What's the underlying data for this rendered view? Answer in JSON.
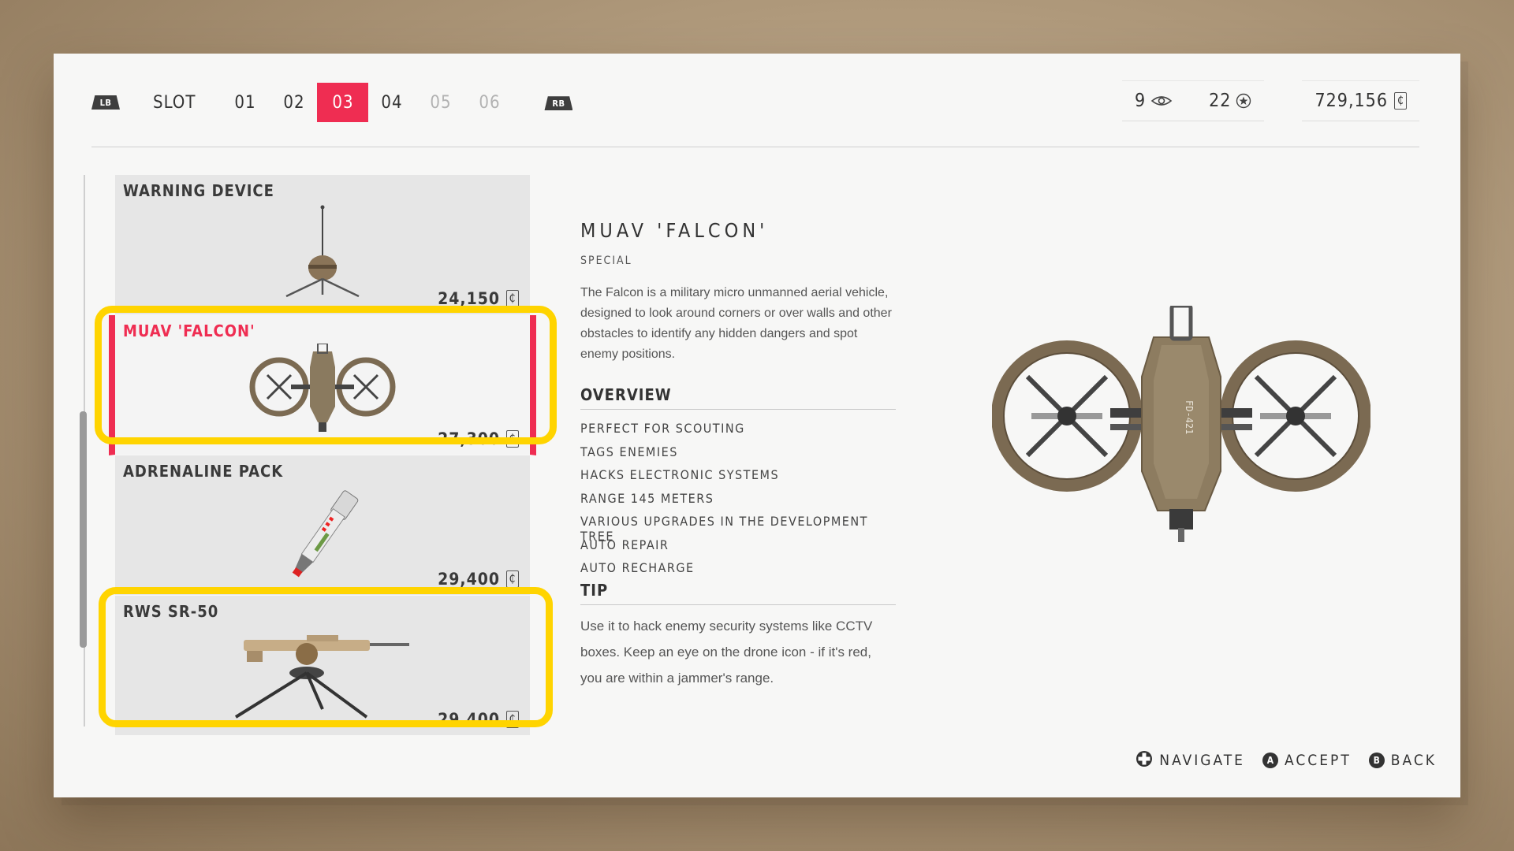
{
  "slot_bar": {
    "left_bumper": "LB",
    "label": "SLOT",
    "slots": [
      {
        "label": "01",
        "state": "normal"
      },
      {
        "label": "02",
        "state": "normal"
      },
      {
        "label": "03",
        "state": "active"
      },
      {
        "label": "04",
        "state": "normal"
      },
      {
        "label": "05",
        "state": "locked"
      },
      {
        "label": "06",
        "state": "locked"
      }
    ],
    "right_bumper": "RB"
  },
  "stats": {
    "drones": "9",
    "drone_icon": "drone-eye-icon",
    "skill_points": "22",
    "skill_icon": "star-icon",
    "credits": "729,156",
    "credit_symbol": "₵"
  },
  "items": [
    {
      "name": "WARNING DEVICE",
      "price": "24,150",
      "icon": "warning-device"
    },
    {
      "name": "MUAV 'FALCON'",
      "price": "27,300",
      "icon": "drone",
      "selected": true
    },
    {
      "name": "ADRENALINE PACK",
      "price": "29,400",
      "icon": "adrenaline-pack"
    },
    {
      "name": "RWS SR-50",
      "price": "29,400",
      "icon": "turret"
    }
  ],
  "detail": {
    "title": "MUAV 'FALCON'",
    "category": "SPECIAL",
    "description": "The Falcon is a military micro unmanned aerial vehicle, designed to look around corners or over walls and other obstacles to identify any hidden dangers and spot enemy positions.",
    "overview_heading": "OVERVIEW",
    "overview": [
      "PERFECT FOR SCOUTING",
      "TAGS ENEMIES",
      "HACKS ELECTRONIC SYSTEMS",
      "RANGE 145 METERS",
      "VARIOUS UPGRADES IN THE DEVELOPMENT TREE",
      "AUTO REPAIR",
      "AUTO RECHARGE"
    ],
    "tip_heading": "TIP",
    "tip": "Use it to hack enemy security systems like CCTV boxes. Keep an eye on the drone icon - if it's red, you are within a jammer's range.",
    "model_marking": "FD-421"
  },
  "footer": {
    "navigate": "NAVIGATE",
    "accept_btn": "A",
    "accept": "ACCEPT",
    "back_btn": "B",
    "back": "BACK"
  },
  "colors": {
    "accent": "#ef2d52",
    "highlight": "#ffd400",
    "panel": "#f7f7f6"
  }
}
